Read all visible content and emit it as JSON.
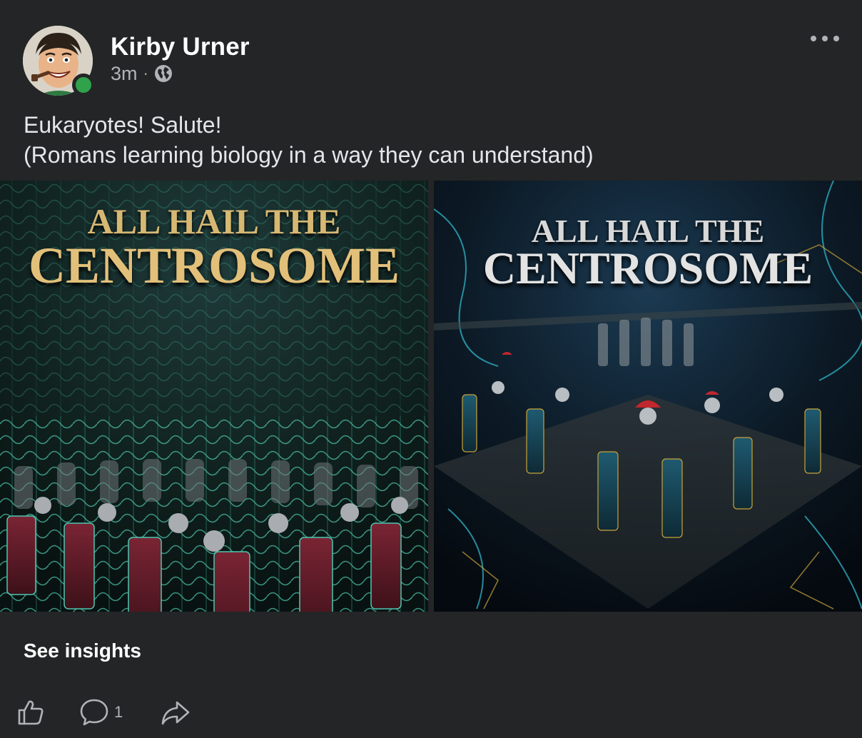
{
  "post": {
    "author": "Kirby Urner",
    "time": "3m",
    "separator": "·",
    "privacy_icon": "globe-icon",
    "more_icon": "more-options-icon",
    "text_lines": [
      "Eukaryotes! Salute!",
      "(Romans learning biology in a way they can understand)"
    ]
  },
  "images": [
    {
      "title_line1": "ALL HAIL THE",
      "title_line2": "CENTROSOME"
    },
    {
      "title_line1": "ALL HAIL THE",
      "title_line2": "CENTROSOME"
    }
  ],
  "footer": {
    "insights_label": "See insights",
    "comment_count": "1",
    "like_icon": "thumbs-up-icon",
    "comment_icon": "comment-icon",
    "share_icon": "share-icon"
  },
  "colors": {
    "background": "#242526",
    "text_primary": "#e4e6eb",
    "text_secondary": "#b0b3b8",
    "online": "#31a24c"
  }
}
